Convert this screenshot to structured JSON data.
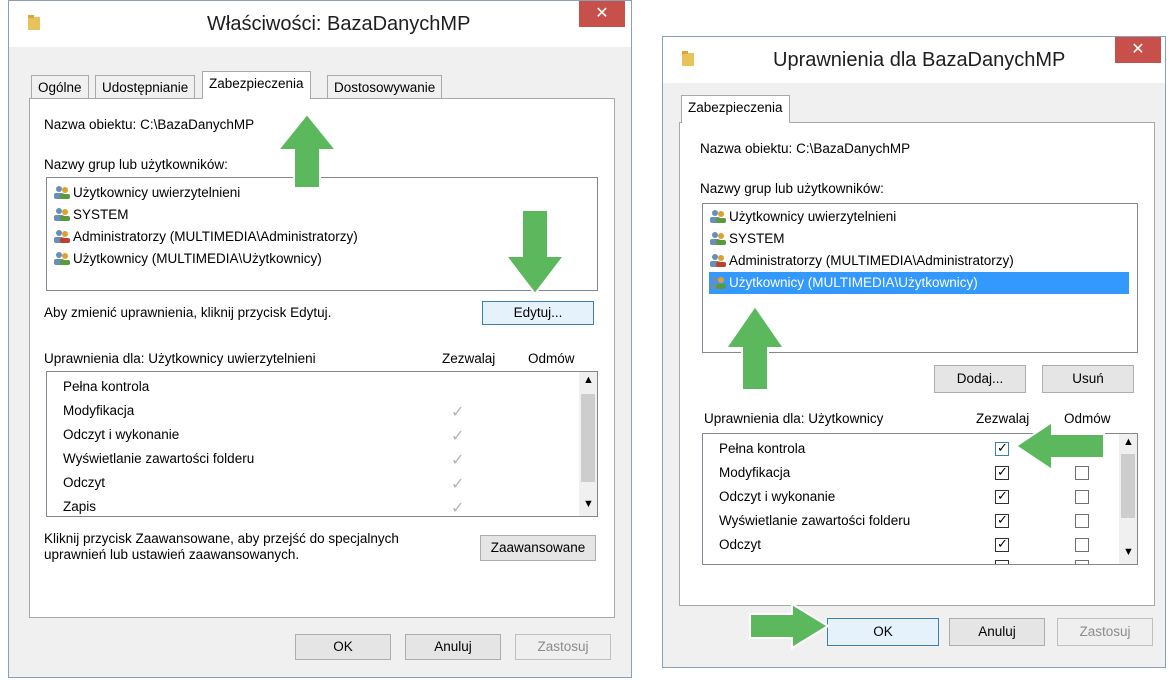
{
  "left_window": {
    "title": "Właściwości: BazaDanychMP",
    "close": "✕",
    "tabs": [
      "Ogólne",
      "Udostępnianie",
      "Zabezpieczenia",
      "Dostosowywanie"
    ],
    "object_name_label": "Nazwa obiektu:",
    "object_name_value": "C:\\BazaDanychMP",
    "groups_label": "Nazwy grup lub użytkowników:",
    "users": [
      "Użytkownicy uwierzytelnieni",
      "SYSTEM",
      "Administratorzy (MULTIMEDIA\\Administratorzy)",
      "Użytkownicy (MULTIMEDIA\\Użytkownicy)"
    ],
    "change_hint": "Aby zmienić uprawnienia, kliknij przycisk Edytuj.",
    "edit_button": "Edytuj...",
    "permissions_for": "Uprawnienia dla: Użytkownicy uwierzytelnieni",
    "allow_header": "Zezwalaj",
    "deny_header": "Odmów",
    "permissions": [
      "Pełna kontrola",
      "Modyfikacja",
      "Odczyt i wykonanie",
      "Wyświetlanie zawartości folderu",
      "Odczyt",
      "Zapis"
    ],
    "advanced_hint_1": "Kliknij przycisk Zaawansowane, aby przejść do specjalnych",
    "advanced_hint_2": "uprawnień lub ustawień zaawansowanych.",
    "advanced_button": "Zaawansowane",
    "ok": "OK",
    "cancel": "Anuluj",
    "apply": "Zastosuj"
  },
  "right_window": {
    "title": "Uprawnienia dla BazaDanychMP",
    "close": "✕",
    "tab": "Zabezpieczenia",
    "object_name_label": "Nazwa obiektu:",
    "object_name_value": "C:\\BazaDanychMP",
    "groups_label": "Nazwy grup lub użytkowników:",
    "users": [
      "Użytkownicy uwierzytelnieni",
      "SYSTEM",
      "Administratorzy (MULTIMEDIA\\Administratorzy)",
      "Użytkownicy (MULTIMEDIA\\Użytkownicy)"
    ],
    "add_button": "Dodaj...",
    "remove_button": "Usuń",
    "permissions_for": "Uprawnienia dla: Użytkownicy",
    "allow_header": "Zezwalaj",
    "deny_header": "Odmów",
    "permissions": [
      "Pełna kontrola",
      "Modyfikacja",
      "Odczyt i wykonanie",
      "Wyświetlanie zawartości folderu",
      "Odczyt"
    ],
    "ok": "OK",
    "cancel": "Anuluj",
    "apply": "Zastosuj"
  },
  "colors": {
    "arrow_green": "#5cb85c",
    "selection": "#3399ff",
    "close_red": "#c7504a"
  }
}
